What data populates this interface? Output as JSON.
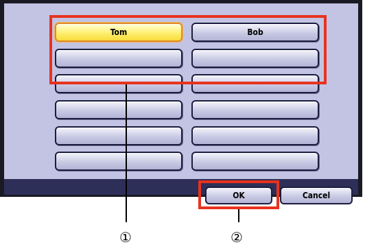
{
  "names": [
    "Tom",
    "Bob",
    "",
    "",
    "",
    "",
    "",
    "",
    "",
    "",
    "",
    ""
  ],
  "buttons": {
    "ok": "OK",
    "cancel": "Cancel"
  },
  "callouts": [
    "①",
    "②"
  ],
  "colors": {
    "highlight": "#e8321e",
    "selected_key": "#ffef70",
    "screen": "#c3c4e3",
    "status_bar": "#2d2f58"
  }
}
